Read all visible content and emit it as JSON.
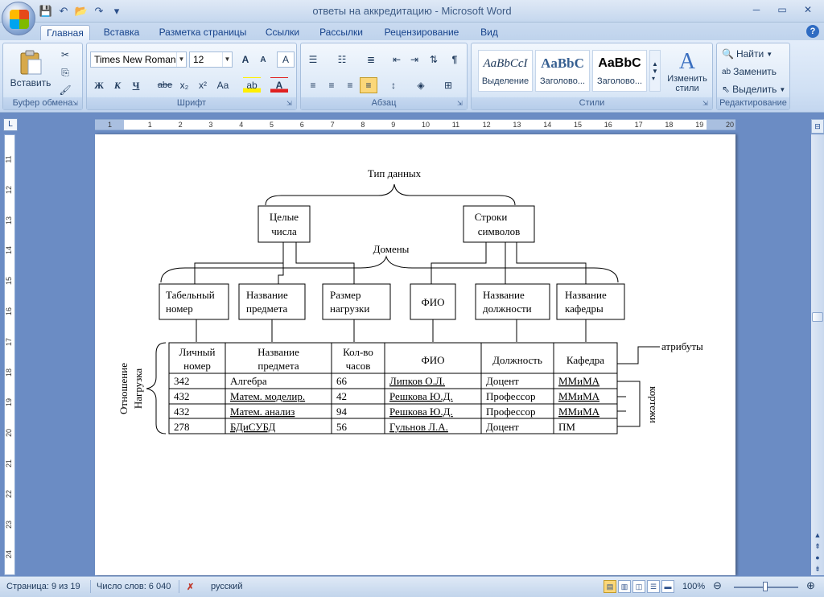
{
  "window": {
    "title": "ответы на аккредитацию - Microsoft Word",
    "min": "─",
    "max": "▭",
    "close": "✕"
  },
  "qat": {
    "save": "💾",
    "undo": "↶",
    "open": "📂",
    "redo": "↷",
    "customize": "▾"
  },
  "tabs": [
    {
      "label": "Главная",
      "active": true
    },
    {
      "label": "Вставка"
    },
    {
      "label": "Разметка страницы"
    },
    {
      "label": "Ссылки"
    },
    {
      "label": "Рассылки"
    },
    {
      "label": "Рецензирование"
    },
    {
      "label": "Вид"
    }
  ],
  "help": "?",
  "ribbon": {
    "clipboard": {
      "label": "Буфер обмена",
      "paste": "Вставить"
    },
    "font": {
      "label": "Шрифт",
      "font_name": "Times New Roman",
      "font_size": "12",
      "bold": "Ж",
      "italic": "К",
      "underline": "Ч",
      "strike": "abe",
      "sub": "x₂",
      "sup": "x²",
      "case": "Aa",
      "grow": "A",
      "shrink": "A",
      "clear": "A"
    },
    "paragraph": {
      "label": "Абзац",
      "pilcrow": "¶"
    },
    "styles": {
      "label": "Стили",
      "items": [
        {
          "sample": "AaBbCcI",
          "name": "Выделение"
        },
        {
          "sample": "AaBbC",
          "name": "Заголово..."
        },
        {
          "sample": "AaBbC",
          "name": "Заголово..."
        }
      ],
      "change": "Изменить стили"
    },
    "editing": {
      "label": "Редактирование",
      "find": "Найти",
      "replace": "Заменить",
      "select": "Выделить"
    }
  },
  "ruler": {
    "h_ticks": [
      "1",
      "1",
      "2",
      "3",
      "4",
      "5",
      "6",
      "7",
      "8",
      "9",
      "10",
      "11",
      "12",
      "13",
      "14",
      "15",
      "16",
      "17",
      "18",
      "19",
      "20"
    ],
    "v_ticks": [
      "11",
      "12",
      "13",
      "14",
      "15",
      "16",
      "17",
      "18",
      "19",
      "20",
      "21",
      "22",
      "23",
      "24"
    ]
  },
  "diagram": {
    "top": "Тип данных",
    "types": [
      [
        "Целые",
        "числа"
      ],
      [
        "Строки",
        "символов"
      ]
    ],
    "domains": "Домены",
    "domain_boxes": [
      [
        "Табельный",
        "номер"
      ],
      [
        "Название",
        "предмета"
      ],
      [
        "Размер",
        "нагрузки"
      ],
      [
        "ФИО"
      ],
      [
        "Название",
        "должности"
      ],
      [
        "Название",
        "кафедры"
      ]
    ],
    "relation_label": [
      "Отношение",
      "Нагрузка"
    ],
    "attributes_label": "атрибуты",
    "tuples_label": "кортежи",
    "table": {
      "headers": [
        [
          "Личный",
          "номер"
        ],
        [
          "Название",
          "предмета"
        ],
        [
          "Кол-во",
          "часов"
        ],
        [
          "ФИО"
        ],
        [
          "Должность"
        ],
        [
          "Кафедра"
        ]
      ],
      "rows": [
        [
          "342",
          "Алгебра",
          "66",
          "Липков О.Л.",
          "Доцент",
          "ММиМА"
        ],
        [
          "432",
          "Матем. моделир.",
          "42",
          "Решкова Ю.Д.",
          "Профессор",
          "ММиМА"
        ],
        [
          "432",
          "Матем. анализ",
          "94",
          "Решкова Ю.Д.",
          "Профессор",
          "ММиМА"
        ],
        [
          "278",
          "БДиСУБД",
          "56",
          "Гульнов Л.А.",
          "Доцент",
          "ПМ"
        ]
      ]
    }
  },
  "status": {
    "page": "Страница: 9 из 19",
    "words": "Число слов: 6 040",
    "language": "русский",
    "zoom": "100%"
  }
}
